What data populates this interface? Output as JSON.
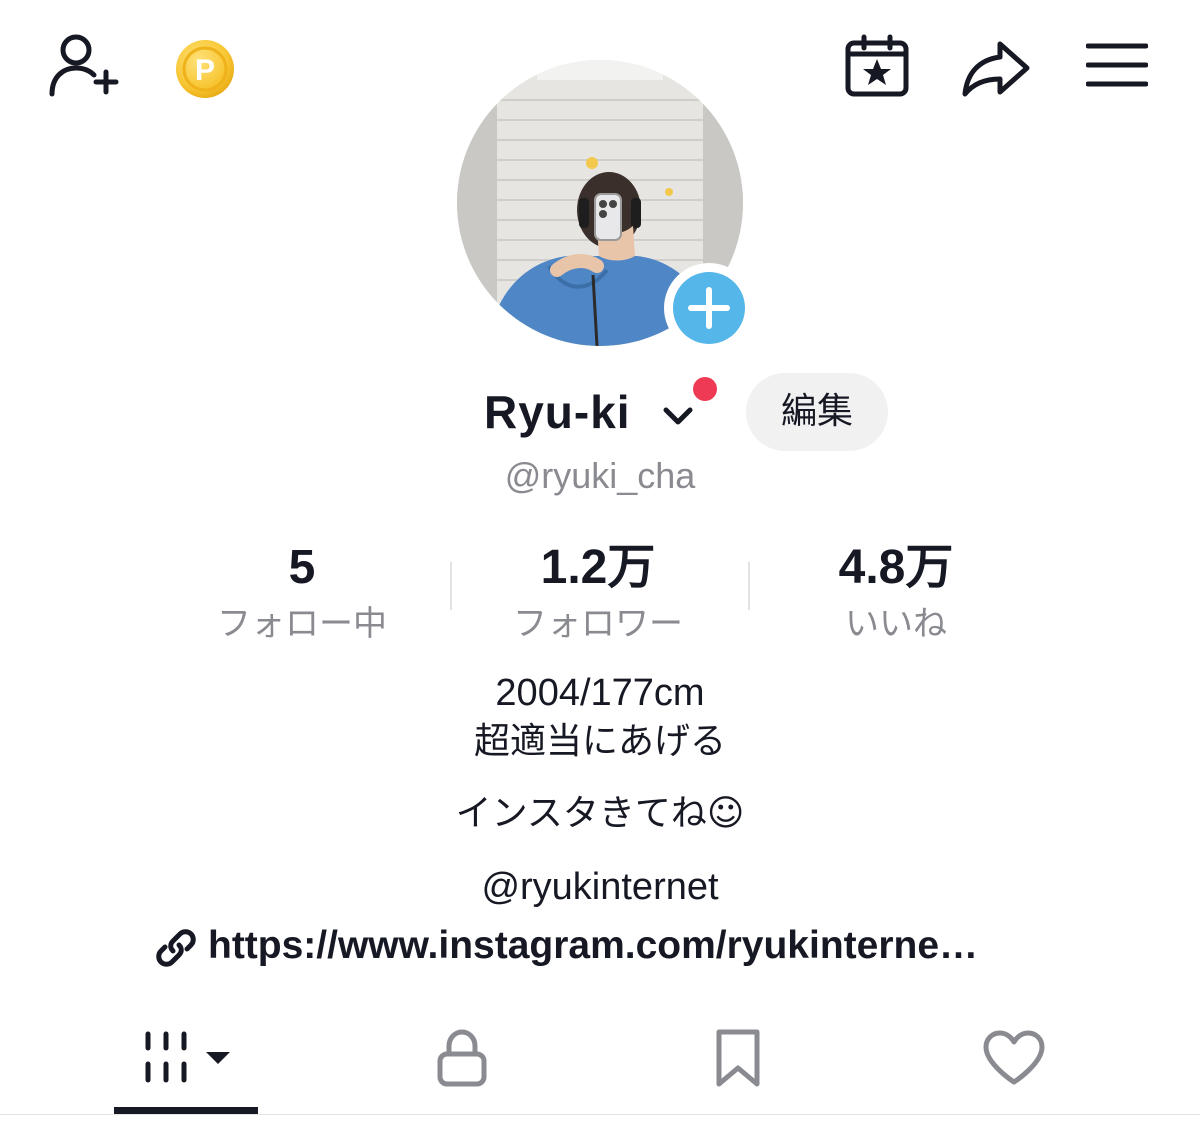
{
  "header": {
    "icons": [
      "add-user-icon",
      "coin-icon",
      "calendar-star-icon",
      "share-icon",
      "menu-icon"
    ]
  },
  "profile": {
    "display_name": "Ryu-ki",
    "username": "@ryuki_cha",
    "edit_label": "編集",
    "notification_color": "#ee3a55",
    "avatar_add_color": "#55b6ea"
  },
  "stats": [
    {
      "value": "5",
      "label": "フォロー中"
    },
    {
      "value": "1.2万",
      "label": "フォロワー"
    },
    {
      "value": "4.8万",
      "label": "いいね"
    }
  ],
  "bio": {
    "line1": "2004/177cm",
    "line2": "超適当にあげる",
    "line3": "インスタきてね☺",
    "line4": "@ryukinternet",
    "link": "https://www.instagram.com/ryukinterne…"
  },
  "tabs": {
    "items": [
      "videos-grid-icon",
      "lock-icon",
      "bookmark-icon",
      "heart-icon"
    ],
    "active": "videos-grid-icon"
  }
}
